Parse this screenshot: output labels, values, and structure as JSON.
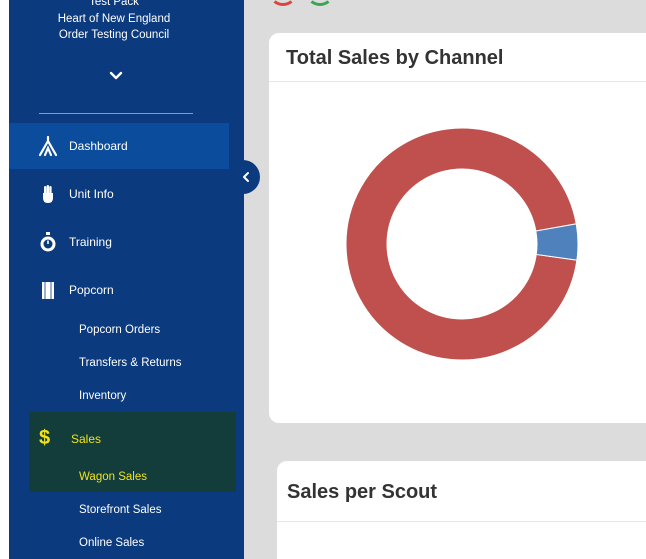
{
  "sidebar": {
    "org_lines": [
      "Test Pack",
      "Heart of New England",
      "Order Testing Council"
    ],
    "nav": [
      {
        "label": "Dashboard",
        "icon": "tent-icon",
        "active": true
      },
      {
        "label": "Unit Info",
        "icon": "hand-icon",
        "active": false
      },
      {
        "label": "Training",
        "icon": "stopwatch-icon",
        "active": false
      },
      {
        "label": "Popcorn",
        "icon": "popcorn-box-icon",
        "active": false
      }
    ],
    "popcorn_sub": [
      "Popcorn Orders",
      "Transfers & Returns",
      "Inventory"
    ],
    "sales": {
      "label": "Sales",
      "icon": "dollar-icon",
      "selected_sub": "Wagon Sales"
    },
    "sales_sub": [
      "Storefront Sales",
      "Online Sales"
    ],
    "accent": "#f2e21c",
    "bg": "#0b3a7e"
  },
  "cards": {
    "total_sales_title": "Total Sales by Channel",
    "sales_per_scout_title": "Sales per Scout"
  },
  "chart_data": {
    "type": "pie",
    "donut": true,
    "slices": [
      {
        "value": 95,
        "color": "#c0504d"
      },
      {
        "value": 5,
        "color": "#4f81bd"
      }
    ]
  }
}
